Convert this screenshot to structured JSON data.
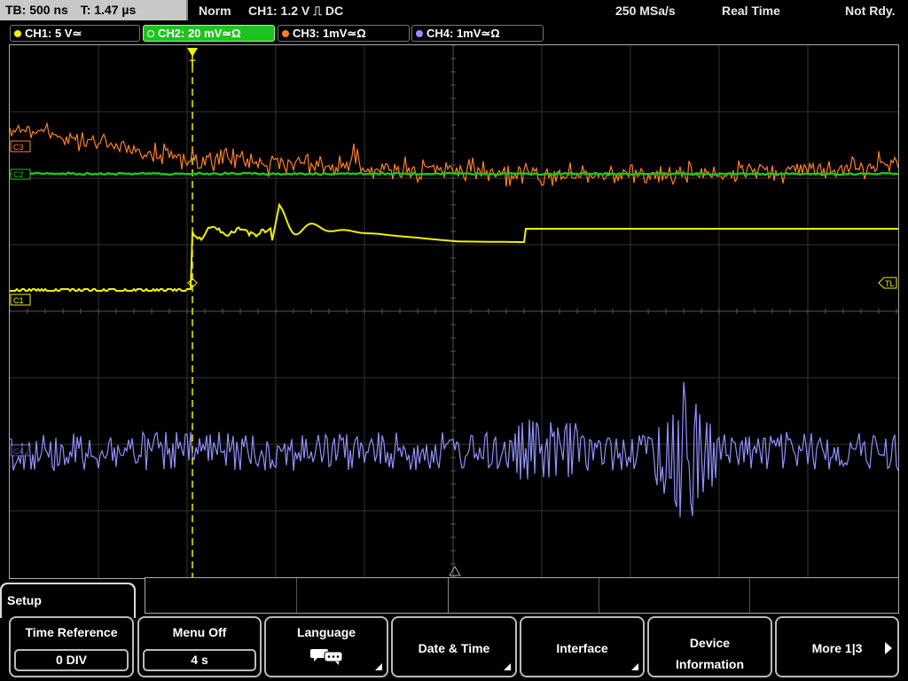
{
  "status": {
    "timebase": "TB: 500 ns",
    "time": "T: 1.47 µs",
    "mode": "Norm",
    "trigger": "CH1: 1.2 V ⎍ DC",
    "sample_rate": "250 MSa/s",
    "acq_mode": "Real Time",
    "state": "Not Rdy."
  },
  "channels": [
    {
      "label": "CH1: 5 V≃",
      "color": "#f0f000"
    },
    {
      "label": "CH2: 20 mV≃Ω",
      "color": "#1fc31f"
    },
    {
      "label": "CH3: 1mV≃Ω",
      "color": "#ff7f27"
    },
    {
      "label": "CH4: 1mV≃Ω",
      "color": "#9090ff"
    }
  ],
  "markers": {
    "c3": "C3",
    "c2": "C2",
    "c1": "C1",
    "c4": "C4",
    "trigger_level": "TL",
    "trigger_pos": "T"
  },
  "menu": {
    "title": "Setup",
    "keys": [
      {
        "label": "Time Reference",
        "value": "0 DIV"
      },
      {
        "label": "Menu Off",
        "value": "4 s"
      },
      {
        "label": "Language",
        "icon": "speech-bubbles-icon"
      },
      {
        "label": "Date & Time"
      },
      {
        "label": "Interface"
      },
      {
        "label": "Device Information"
      },
      {
        "label": "More 1|3"
      }
    ]
  },
  "colors": {
    "ch1": "#f0f000",
    "ch2": "#1fc31f",
    "ch3": "#ff7f27",
    "ch4": "#9090ff",
    "grid": "#3a3a3a"
  }
}
